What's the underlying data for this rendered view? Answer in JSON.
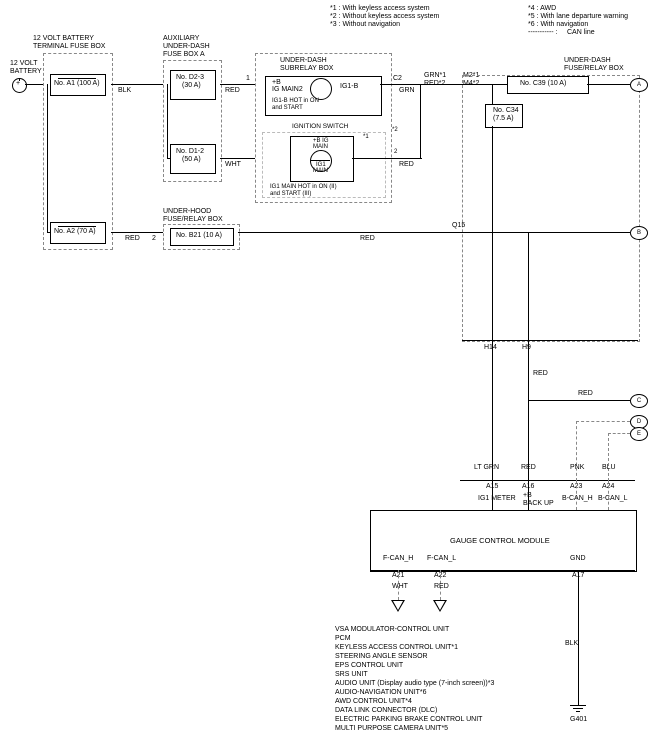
{
  "legend": {
    "n1": "*1 : With keyless access system",
    "n2": "*2 : Without keyless access system",
    "n3": "*3 : Without navigation",
    "n4": "*4 : AWD",
    "n5": "*5 : With lane departure warning",
    "n6": "*6 : With navigation",
    "can": "CAN line",
    "can_marker": "----------- :"
  },
  "battery": {
    "label1": "12 VOLT",
    "label2": "BATTERY"
  },
  "termbox": {
    "title1": "12 VOLT BATTERY",
    "title2": "TERMINAL FUSE BOX",
    "fuseA1": "No. A1 (100 A)",
    "fuseA2": "No. A2 (70 A)"
  },
  "auxbox": {
    "title1": "AUXILIARY",
    "title2": "UNDER-DASH",
    "title3": "FUSE BOX A",
    "fuseD23": "No. D2-3",
    "fuseD23amp": "(30 A)",
    "fuseD12": "No. D1-2",
    "fuseD12amp": "(50 A)"
  },
  "underhood": {
    "title1": "UNDER-HOOD",
    "title2": "FUSE/RELAY BOX",
    "fuseB21": "No. B21 (10 A)"
  },
  "subrelay": {
    "title1": "UNDER-DASH",
    "title2": "SUBRELAY BOX",
    "relay1a": "+B",
    "relay1b": "IG MAIN2",
    "relay1name": "IG1-B",
    "relay1note1": "IG1-B HOT in ON",
    "relay1note2": "and START",
    "ignition_title": "IGNITION SWITCH",
    "relay2a": "+B IG",
    "relay2b": "MAIN",
    "relay2c": "IG1",
    "relay2d": "MAIN",
    "relay2note1": "IG1 MAIN HOT in ON (II)",
    "relay2note2": "and START (III)"
  },
  "underdash": {
    "title1": "UNDER-DASH",
    "title2": "FUSE/RELAY BOX",
    "fuseC39": "No. C39 (10 A)",
    "fuseC34": "No. C34",
    "fuseC34amp": "(7.5 A)"
  },
  "wires": {
    "blk1": "BLK",
    "red_aux_top": "RED",
    "red_aux_bot": "WHT",
    "grn": "GRN",
    "m2": "M2*1",
    "m4": "M4*2",
    "grnred": "GRN*1",
    "grnred2": "RED*2",
    "red_b21": "RED",
    "red_q15": "RED",
    "q15": "Q15",
    "pin2": "2",
    "h14": "H14",
    "h9": "H9",
    "red_h9": "RED",
    "red_c": "RED",
    "ltgrn": "LT GRN",
    "red_a16": "RED",
    "pnk": "PNK",
    "blu": "BLU",
    "a15": "A15",
    "a16": "A16",
    "a23": "A23",
    "a24": "A24",
    "ig1meter": "IG1 METER",
    "bbackup": "+B\nBACK UP",
    "bcanh": "B-CAN_H",
    "bcanl": "B-CAN_L",
    "fcanh": "F-CAN_H",
    "fcanl": "F-CAN_L",
    "a21": "A21",
    "a22": "A22",
    "wht": "WHT",
    "red_a22": "RED",
    "gnd": "GND",
    "a17": "A17",
    "blk2": "BLK",
    "c2": "C2",
    "sup1": "*1",
    "sup2": "*2",
    "pin1_top": "1"
  },
  "module": {
    "name": "GAUGE CONTROL MODULE"
  },
  "destinations": [
    "VSA MODULATOR-CONTROL UNIT",
    "PCM",
    "KEYLESS ACCESS CONTROL UNIT*1",
    "STEERING ANGLE SENSOR",
    "EPS CONTROL UNIT",
    "SRS UNIT",
    "AUDIO UNIT (Display audio type (7-inch screen))*3",
    "AUDIO-NAVIGATION UNIT*6",
    "AWD CONTROL UNIT*4",
    "DATA LINK CONNECTOR (DLC)",
    "ELECTRIC PARKING BRAKE CONTROL UNIT",
    "MULTI PURPOSE CAMERA UNIT*5"
  ],
  "nodes": {
    "a": "A",
    "b": "B",
    "c": "C",
    "d": "D",
    "e": "E"
  },
  "g401": "G401"
}
